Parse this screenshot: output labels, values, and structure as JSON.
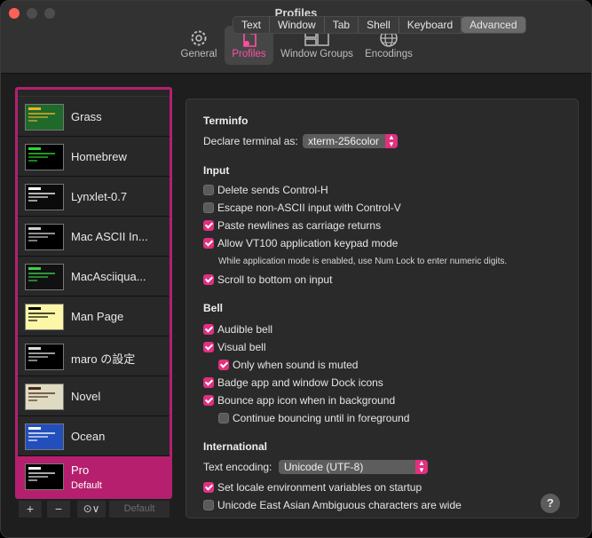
{
  "window": {
    "title": "Profiles"
  },
  "toolbar": {
    "items": [
      {
        "label": "General",
        "icon": "gear-icon"
      },
      {
        "label": "Profiles",
        "icon": "profile-doc-icon",
        "active": true
      },
      {
        "label": "Window Groups",
        "icon": "window-groups-icon"
      },
      {
        "label": "Encodings",
        "icon": "globe-icon"
      }
    ]
  },
  "profiles": [
    {
      "name": "Grass",
      "thumb_bg": "#1e6a2b",
      "thumb_fg": "#f2b12b"
    },
    {
      "name": "Homebrew",
      "thumb_bg": "#000000",
      "thumb_fg": "#2cdb2c"
    },
    {
      "name": "Lynxlet-0.7",
      "thumb_bg": "#0b0b0b",
      "thumb_fg": "#ffffff"
    },
    {
      "name": "Mac ASCII In...",
      "thumb_bg": "#000000",
      "thumb_fg": "#d0d0d0"
    },
    {
      "name": "MacAsciiqua...",
      "thumb_bg": "#111111",
      "thumb_fg": "#3bd04a"
    },
    {
      "name": "Man Page",
      "thumb_bg": "#fdf6a6",
      "thumb_fg": "#000000"
    },
    {
      "name": "maro の設定",
      "thumb_bg": "#000000",
      "thumb_fg": "#dddddd"
    },
    {
      "name": "Novel",
      "thumb_bg": "#dfdbc3",
      "thumb_fg": "#4a2b1a"
    },
    {
      "name": "Ocean",
      "thumb_bg": "#224fbc",
      "thumb_fg": "#ffffff"
    },
    {
      "name": "Pro",
      "sub": "Default",
      "thumb_bg": "#000000",
      "thumb_fg": "#f2f2f2",
      "selected": true
    }
  ],
  "list_footer": {
    "add": "+",
    "remove": "−",
    "more": "⊙∨",
    "default": "Default"
  },
  "tabs": [
    "Text",
    "Window",
    "Tab",
    "Shell",
    "Keyboard",
    "Advanced"
  ],
  "active_tab": "Advanced",
  "terminfo": {
    "heading": "Terminfo",
    "declare_label": "Declare terminal as:",
    "declare_value": "xterm-256color"
  },
  "input": {
    "heading": "Input",
    "options": [
      {
        "label": "Delete sends Control-H",
        "checked": false
      },
      {
        "label": "Escape non-ASCII input with Control-V",
        "checked": false
      },
      {
        "label": "Paste newlines as carriage returns",
        "checked": true
      },
      {
        "label": "Allow VT100 application keypad mode",
        "checked": true
      }
    ],
    "note": "While application mode is enabled, use Num Lock to enter numeric digits.",
    "scroll_label": "Scroll to bottom on input",
    "scroll_checked": true
  },
  "bell": {
    "heading": "Bell",
    "options": [
      {
        "label": "Audible bell",
        "checked": true
      },
      {
        "label": "Visual bell",
        "checked": true
      },
      {
        "label": "Only when sound is muted",
        "checked": true,
        "indent": true
      },
      {
        "label": "Badge app and window Dock icons",
        "checked": true
      },
      {
        "label": "Bounce app icon when in background",
        "checked": true
      },
      {
        "label": "Continue bouncing until in foreground",
        "checked": false,
        "indent": true
      }
    ]
  },
  "international": {
    "heading": "International",
    "encoding_label": "Text encoding:",
    "encoding_value": "Unicode (UTF-8)",
    "options": [
      {
        "label": "Set locale environment variables on startup",
        "checked": true
      },
      {
        "label": "Unicode East Asian Ambiguous characters are wide",
        "checked": false
      }
    ]
  },
  "help": "?",
  "colors": {
    "accent": "#e0307f",
    "selection": "#b51f6d"
  }
}
